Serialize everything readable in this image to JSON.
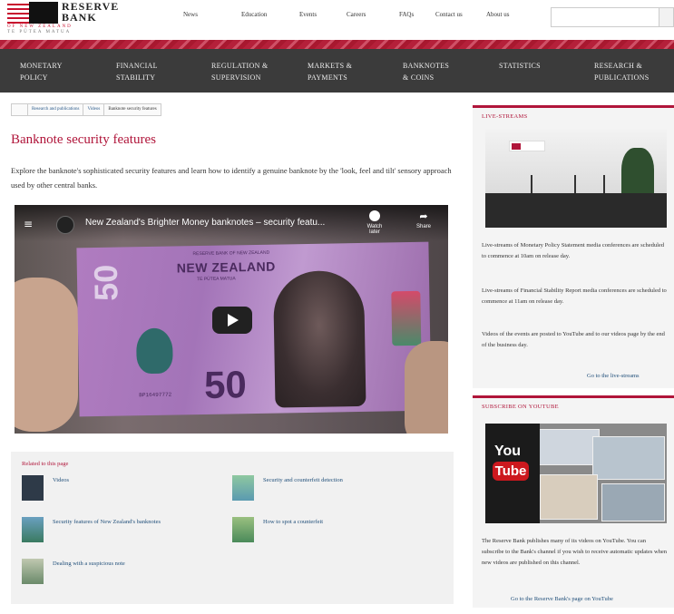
{
  "header": {
    "logo_line1": "RESERVE",
    "logo_line2": "BANK",
    "logo_sub1": "OF NEW ZEALAND",
    "logo_sub2": "TE PŪTEA MATUA",
    "top_links": [
      "News",
      "Education",
      "Events",
      "Careers",
      "FAQs",
      "Contact us",
      "About us"
    ],
    "search_placeholder": ""
  },
  "main_nav": [
    {
      "line1": "MONETARY",
      "line2": "POLICY"
    },
    {
      "line1": "FINANCIAL",
      "line2": "STABILITY"
    },
    {
      "line1": "REGULATION &",
      "line2": "SUPERVISION"
    },
    {
      "line1": "MARKETS &",
      "line2": "PAYMENTS"
    },
    {
      "line1": "BANKNOTES",
      "line2": "& COINS"
    },
    {
      "line1": "STATISTICS",
      "line2": ""
    },
    {
      "line1": "RESEARCH &",
      "line2": "PUBLICATIONS"
    }
  ],
  "breadcrumb": [
    "Research and publications",
    "Videos",
    "Banknote security features"
  ],
  "page": {
    "title": "Banknote security features",
    "intro": "Explore the banknote's sophisticated security features and learn how to identify a genuine banknote by the 'look, feel and tilt' sensory approach used by other central banks."
  },
  "video": {
    "title": "New Zealand's Brighter Money banknotes – security featu...",
    "watch_later": "Watch later",
    "share": "Share",
    "note_bank": "RESERVE BANK OF NEW ZEALAND",
    "note_country": "NEW ZEALAND",
    "note_maori": "TE PŪTEA MATUA",
    "note_value": "50",
    "note_serial": "BP16497772"
  },
  "related": {
    "title": "Related to this page",
    "items": [
      "Videos",
      "Security and counterfeit detection",
      "Security features of New Zealand's banknotes",
      "How to spot a counterfeit",
      "Dealing with a suspicious note"
    ]
  },
  "sidebar": {
    "live": {
      "title": "LIVE-STREAMS",
      "p1": "Live-streams of Monetary Policy Statement media conferences are scheduled to commence at 10am on release day.",
      "p2": "Live-streams of Financial Stability Report media conferences are scheduled to commence at 11am on release day.",
      "p3": "Videos of the events are posted to YouTube and to our videos page by the end of the business day.",
      "link": "Go to the live-streams"
    },
    "youtube": {
      "title": "SUBSCRIBE ON YOUTUBE",
      "logo_you": "You",
      "logo_tube": "Tube",
      "p1": "The Reserve Bank publishes many of its videos on YouTube. You can subscribe to the Bank's channel if you wish to receive automatic updates when new videos are published on this channel.",
      "link": "Go to the Reserve Bank's page on YouTube"
    }
  },
  "colors": {
    "brand_red": "#b0153a",
    "nav_bg": "#3b3b3b",
    "link": "#1f4e79"
  }
}
